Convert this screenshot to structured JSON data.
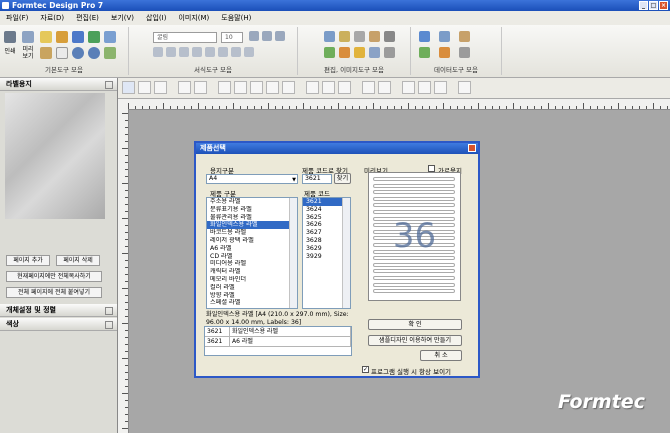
{
  "app": {
    "title": "Formtec Design Pro 7"
  },
  "menu": [
    "파일(F)",
    "자료(D)",
    "편집(E)",
    "보기(V)",
    "삽입(I)",
    "이미지(M)",
    "도움말(H)"
  ],
  "ribbon": {
    "groups": [
      "기본도구 모음",
      "서식도구 모음",
      "편집, 이미지도구 모음",
      "데이터도구 모음"
    ],
    "print_label": "인쇄",
    "preview_label": "미리 보기",
    "font_value": "굴림",
    "size_value": "10"
  },
  "left_panel": {
    "label_paper_header": "라벨용지",
    "buttons": [
      "페이지 추가",
      "페이지 삭제",
      "현재페이지에만 전체복사하기",
      "전체 페이지에 전체 붙여넣기"
    ],
    "sections": [
      "개체설정 및 정렬",
      "색상"
    ]
  },
  "dialog": {
    "title": "제품선택",
    "paper_type_label": "용지구분",
    "paper_type_value": "A4",
    "code_search_label": "제품 코드로 찾기",
    "code_search_value": "3621",
    "search_button": "찾기",
    "product_type_label": "제품 구분",
    "product_types": [
      "주소용 라벨",
      "분류표기용 라벨",
      "물류관리용 라벨",
      "화일인덱스용 라벨",
      "바코드용 라벨",
      "레이저 광택 라벨",
      "A6 라벨",
      "CD 라벨",
      "미디어용 라벨",
      "캐릭터 라벨",
      "메모리 바인더",
      "컬러 라벨",
      "방향 라벨",
      "스페셜 라벨"
    ],
    "selected_type_index": 3,
    "product_code_label": "제품 코드",
    "product_codes": [
      "3621",
      "3624",
      "3625",
      "3626",
      "3627",
      "3628",
      "3629",
      "3929"
    ],
    "selected_code_index": 0,
    "preview_label": "미리보기",
    "landscape_label": "가로용지",
    "preview_number": "36",
    "info_text": "화일인덱스용 라벨 [A4 (210.0 x 297.0 mm), Size: 96.00 x 14.00 mm, Labels: 36]",
    "results": [
      {
        "code": "3621",
        "name": "화일인덱스용 라벨"
      },
      {
        "code": "3621",
        "name": "A6 라벨"
      }
    ],
    "ok_button": "확 인",
    "sample_button": "샘플디자인 이용하여 만들기",
    "cancel_button": "취 소",
    "startup_label": "프로그램 실행 시 항상 보이기"
  },
  "brand": {
    "logo": "Formtec"
  },
  "colors": {
    "titlebar": "#1b4fb8",
    "selection": "#316ac5",
    "workspace": "#a7a7a7"
  }
}
